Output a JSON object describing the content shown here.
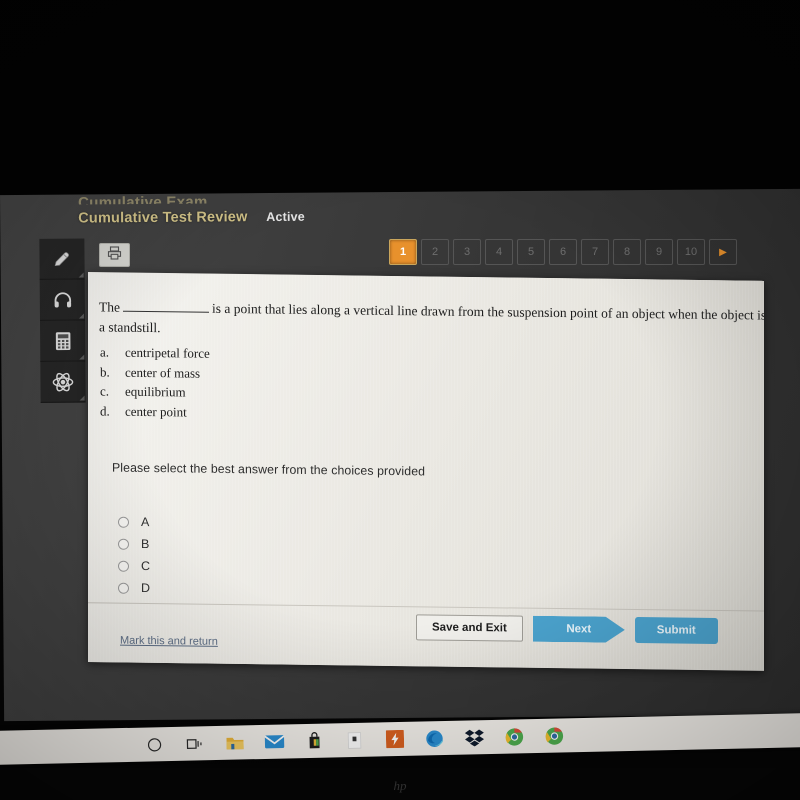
{
  "header": {
    "cutoff_title": "Cumulative Exam",
    "title": "Cumulative Test Review",
    "status": "Active"
  },
  "toolbar": {
    "print_icon": "printer-icon",
    "rail_items": [
      {
        "icon": "pencil-highlighter-icon",
        "label": "Highlighter"
      },
      {
        "icon": "headphones-icon",
        "label": "Read Aloud"
      },
      {
        "icon": "calculator-icon",
        "label": "Calculator"
      },
      {
        "icon": "atom-icon",
        "label": "Periodic Table"
      }
    ]
  },
  "pager": {
    "items": [
      "1",
      "2",
      "3",
      "4",
      "5",
      "6",
      "7",
      "8",
      "9",
      "10"
    ],
    "active_index": 0,
    "next_arrow": "▶"
  },
  "question": {
    "lead": "The",
    "blank": "",
    "line1_rest": "is a point that lies along a vertical line drawn from the suspension point of an object when the object is at",
    "line2": "a standstill.",
    "choices": [
      {
        "letter": "a.",
        "text": "centripetal force"
      },
      {
        "letter": "b.",
        "text": "center of mass"
      },
      {
        "letter": "c.",
        "text": "equilibrium"
      },
      {
        "letter": "d.",
        "text": "center point"
      }
    ],
    "prompt": "Please select the best answer from the choices provided",
    "options": [
      {
        "label": "A",
        "selected": false
      },
      {
        "label": "B",
        "selected": false
      },
      {
        "label": "C",
        "selected": false
      },
      {
        "label": "D",
        "selected": false
      }
    ]
  },
  "footer": {
    "mark_link": "Mark this and return",
    "save_label": "Save and Exit",
    "next_label": "Next",
    "submit_label": "Submit"
  },
  "taskbar": {
    "icons": [
      "cortana-circle-icon",
      "task-view-icon",
      "file-explorer-icon",
      "mail-icon",
      "microsoft-store-icon",
      "white-app-icon",
      "orange-lightning-icon",
      "edge-icon",
      "dropbox-icon",
      "chrome-icon",
      "chrome-icon-2"
    ]
  },
  "device": {
    "brand": "hp"
  },
  "colors": {
    "accent_orange": "#e8912c",
    "accent_blue": "#4ba3ce",
    "header_gold": "#d9c98a",
    "chrome_dark": "#3c3c3c"
  }
}
